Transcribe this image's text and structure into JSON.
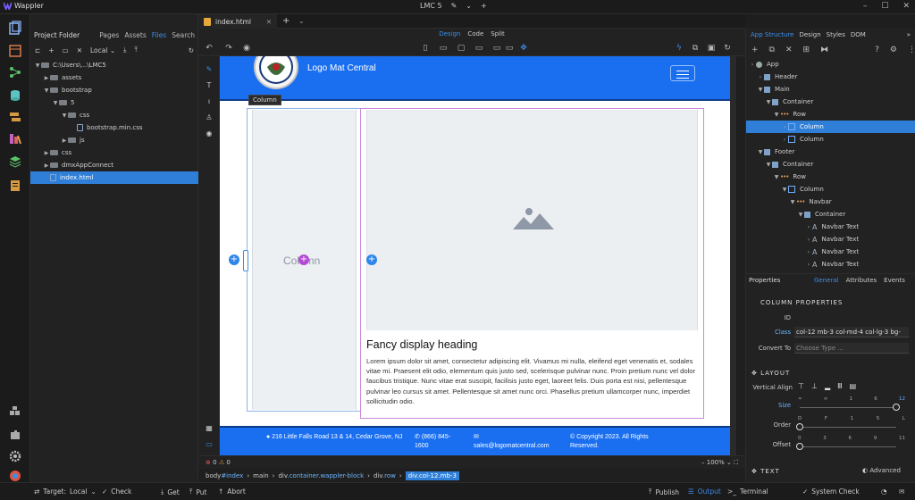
{
  "app": {
    "name": "Wappler",
    "project": "LMC 5"
  },
  "project_panel": {
    "title": "Project Folder",
    "tabs": [
      "Pages",
      "Assets",
      "Files",
      "Search"
    ],
    "active_tab": "Files",
    "target": "Local",
    "tree": [
      {
        "label": "C:\\Users\\...\\LMC5",
        "depth": 0,
        "type": "folder",
        "open": true
      },
      {
        "label": "assets",
        "depth": 1,
        "type": "folder",
        "open": false
      },
      {
        "label": "bootstrap",
        "depth": 1,
        "type": "folder",
        "open": true
      },
      {
        "label": "5",
        "depth": 2,
        "type": "folder",
        "open": true
      },
      {
        "label": "css",
        "depth": 3,
        "type": "folder",
        "open": true
      },
      {
        "label": "bootstrap.min.css",
        "depth": 4,
        "type": "file"
      },
      {
        "label": "js",
        "depth": 3,
        "type": "folder",
        "open": false
      },
      {
        "label": "css",
        "depth": 1,
        "type": "folder",
        "open": false
      },
      {
        "label": "dmxAppConnect",
        "depth": 1,
        "type": "folder",
        "open": false
      },
      {
        "label": "index.html",
        "depth": 1,
        "type": "file",
        "selected": true
      }
    ]
  },
  "editor": {
    "tab": "index.html",
    "modes": [
      "Design",
      "Code",
      "Split"
    ],
    "active_mode": "Design",
    "zoom": "100%",
    "errors": "0",
    "warnings": "0"
  },
  "page": {
    "brand": "Logo Mat Central",
    "tooltip": "Column",
    "column_label": "Column",
    "heading": "Fancy display heading",
    "body": "Lorem ipsum dolor sit amet, consectetur adipiscing elit. Vivamus mi nulla, eleifend eget venenatis et, sodales vitae mi. Praesent elit odio, elementum quis justo sed, scelerisque pulvinar nunc. Proin pretium nunc vel dolor faucibus tristique. Nunc vitae erat suscipit, facilisis justo eget, laoreet felis. Duis porta est nisi, pellentesque pulvinar leo cursus sit amet. Pellentesque sit amet nunc orci. Phasellus pretium ullamcorper nunc, imperdiet sollicitudin odio.",
    "footer": {
      "address": "216 Little Falls Road 13 & 14, Cedar Grove, NJ",
      "phone": "(866) 845-1600",
      "email": "sales@logomatcentral.com",
      "copyright": "© Copyright 2023. All Rights Reserved."
    }
  },
  "breadcrumbs": [
    {
      "tag": "body",
      "cls": "#index"
    },
    {
      "tag": "main",
      "cls": ""
    },
    {
      "tag": "div",
      "cls": ".container.wappler-block"
    },
    {
      "tag": "div",
      "cls": ".row"
    },
    {
      "tag": "div",
      "cls": ".col-12.mb-3",
      "current": true
    }
  ],
  "status": {
    "target_label": "Target:",
    "target": "Local",
    "actions": [
      "Check",
      "Get",
      "Put",
      "Abort"
    ],
    "right": [
      "Publish",
      "Output",
      "Terminal",
      "System Check"
    ]
  },
  "structure": {
    "tabs": [
      "App Structure",
      "Design",
      "Styles",
      "DOM"
    ],
    "active_tab": "App Structure",
    "tree": [
      {
        "label": "App",
        "depth": 0,
        "icon": "app"
      },
      {
        "label": "Header",
        "depth": 1,
        "icon": "sq"
      },
      {
        "label": "Main",
        "depth": 1,
        "icon": "sq",
        "open": true
      },
      {
        "label": "Container",
        "depth": 2,
        "icon": "sq",
        "open": true
      },
      {
        "label": "Row",
        "depth": 3,
        "icon": "dots",
        "open": true
      },
      {
        "label": "Column",
        "depth": 4,
        "icon": "col",
        "selected": true
      },
      {
        "label": "Column",
        "depth": 4,
        "icon": "col"
      },
      {
        "label": "Footer",
        "depth": 1,
        "icon": "sq",
        "open": true
      },
      {
        "label": "Container",
        "depth": 2,
        "icon": "sq",
        "open": true
      },
      {
        "label": "Row",
        "depth": 3,
        "icon": "dots",
        "open": true
      },
      {
        "label": "Column",
        "depth": 4,
        "icon": "col",
        "open": true
      },
      {
        "label": "Navbar",
        "depth": 5,
        "icon": "dots",
        "open": true
      },
      {
        "label": "Container",
        "depth": 6,
        "icon": "sq",
        "open": true
      },
      {
        "label": "Navbar Text",
        "depth": 7,
        "icon": "aa"
      },
      {
        "label": "Navbar Text",
        "depth": 7,
        "icon": "aa"
      },
      {
        "label": "Navbar Text",
        "depth": 7,
        "icon": "aa"
      },
      {
        "label": "Navbar Text",
        "depth": 7,
        "icon": "aa"
      }
    ]
  },
  "properties": {
    "title": "Properties",
    "tabs": [
      "General",
      "Attributes",
      "Events"
    ],
    "active_tab": "General",
    "section_column": "COLUMN PROPERTIES",
    "id_label": "ID",
    "class_label": "Class",
    "class_value": "col-12 mb-3 col-md-4 col-lg-3 bg-",
    "convert_label": "Convert To",
    "convert_placeholder": "Choose Type ...",
    "section_layout": "LAYOUT",
    "valign_label": "Vertical Align",
    "size_label": "Size",
    "size_ticks": [
      "≈",
      "∞",
      "1",
      "6",
      "12"
    ],
    "size_value": 12,
    "order_label": "Order",
    "order_ticks": [
      "D",
      "F",
      "1",
      "5",
      "L"
    ],
    "offset_label": "Offset",
    "offset_ticks": [
      "0",
      "3",
      "6",
      "9",
      "11"
    ],
    "section_text": "TEXT",
    "advanced": "Advanced"
  }
}
